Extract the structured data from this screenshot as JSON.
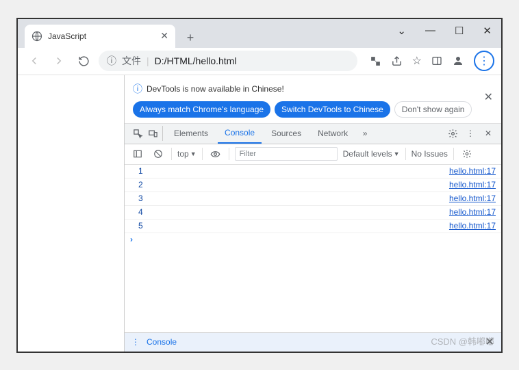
{
  "window": {
    "tab_title": "JavaScript"
  },
  "address_bar": {
    "file_label": "文件",
    "url": "D:/HTML/hello.html"
  },
  "devtools": {
    "banner": {
      "message": "DevTools is now available in Chinese!",
      "btn_match": "Always match Chrome's language",
      "btn_switch": "Switch DevTools to Chinese",
      "btn_dismiss": "Don't show again"
    },
    "tabs": {
      "elements": "Elements",
      "console": "Console",
      "sources": "Sources",
      "network": "Network"
    },
    "console_toolbar": {
      "context": "top",
      "filter_placeholder": "Filter",
      "levels": "Default levels",
      "issues": "No Issues"
    },
    "logs": [
      {
        "value": "1",
        "source": "hello.html:17"
      },
      {
        "value": "2",
        "source": "hello.html:17"
      },
      {
        "value": "3",
        "source": "hello.html:17"
      },
      {
        "value": "4",
        "source": "hello.html:17"
      },
      {
        "value": "5",
        "source": "hello.html:17"
      }
    ],
    "footer_label": "Console"
  },
  "watermark": "CSDN @韩嘟嘟"
}
